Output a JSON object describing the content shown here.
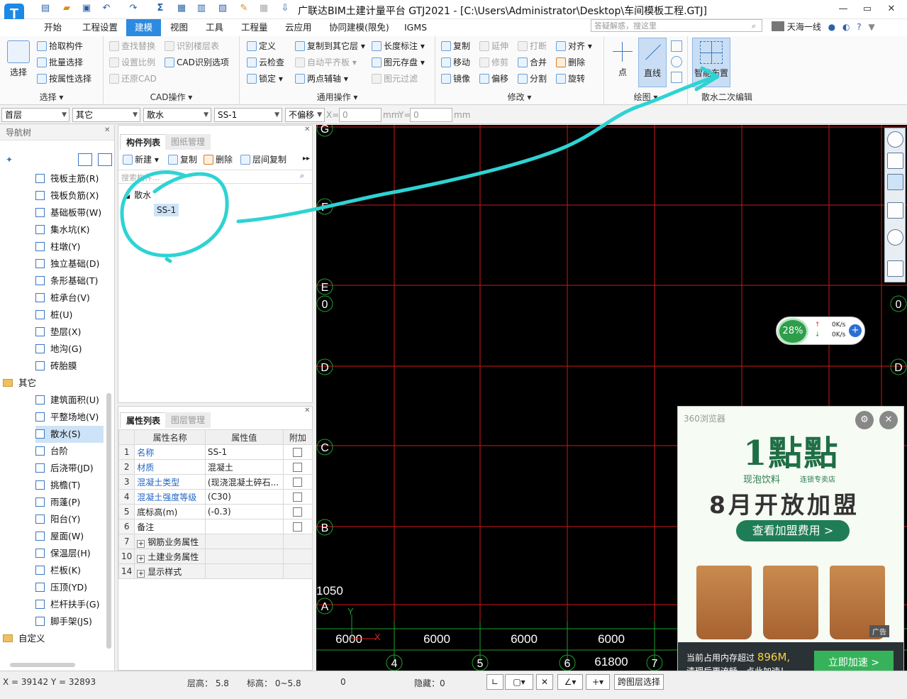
{
  "title": {
    "window_title": "广联达BIM土建计量平台 GTJ2021 - [C:\\Users\\Administrator\\Desktop\\车间模板工程.GTJ]",
    "logo_letter": "T",
    "minimize": "—",
    "restore": "▭",
    "close": "✕"
  },
  "tabs": [
    "开始",
    "工程设置",
    "建模",
    "视图",
    "工具",
    "工程量",
    "云应用",
    "协同建模(限免)",
    "IGMS"
  ],
  "search": {
    "placeholder": "答疑解惑，搜这里"
  },
  "user": {
    "name": "天海一线"
  },
  "ribbon": {
    "select": {
      "big": "选择",
      "label": "选择 ▾",
      "items": [
        "拾取构件",
        "批量选择",
        "按属性选择"
      ]
    },
    "cad": {
      "label": "CAD操作 ▾",
      "items": [
        "查找替换",
        "设置比例",
        "还原CAD",
        "识别楼层表",
        "CAD识别选项"
      ]
    },
    "general": {
      "label": "通用操作 ▾",
      "items": [
        "定义",
        "云检查",
        "锁定 ▾",
        "复制到其它层 ▾",
        "自动平齐板 ▾",
        "两点辅轴 ▾",
        "长度标注 ▾",
        "图元存盘 ▾",
        "图元过滤"
      ]
    },
    "modify": {
      "label": "修改 ▾",
      "items": [
        "复制",
        "移动",
        "镜像",
        "延伸",
        "修剪",
        "偏移",
        "打断",
        "合并",
        "分割",
        "对齐 ▾",
        "删除",
        "旋转"
      ]
    },
    "draw": {
      "label": "绘图 ▾",
      "items": [
        "点",
        "直线"
      ]
    },
    "sanshui": {
      "label": "散水二次编辑",
      "big": "智能布置"
    }
  },
  "combos": {
    "floor": "首层",
    "category": "其它",
    "type": "散水",
    "component": "SS-1",
    "offset": "不偏移",
    "x_label": "X=",
    "x_value": "0",
    "x_unit": "mm",
    "y_label": "Y=",
    "y_value": "0",
    "y_unit": "mm"
  },
  "nav": {
    "title": "导航树",
    "items_top": [
      "筏板主筋(R)",
      "筏板负筋(X)",
      "基础板带(W)",
      "集水坑(K)",
      "柱墩(Y)",
      "独立基础(D)",
      "条形基础(T)",
      "桩承台(V)",
      "桩(U)",
      "垫层(X)",
      "地沟(G)",
      "砖胎膜"
    ],
    "folder_other": "其它",
    "items_other": [
      "建筑面积(U)",
      "平整场地(V)",
      "散水(S)",
      "台阶",
      "后浇带(JD)",
      "挑檐(T)",
      "雨蓬(P)",
      "阳台(Y)",
      "屋面(W)",
      "保温层(H)",
      "栏板(K)",
      "压顶(YD)",
      "栏杆扶手(G)",
      "脚手架(JS)"
    ],
    "folder_custom": "自定义",
    "selected": "散水(S)"
  },
  "complist": {
    "tab1": "构件列表",
    "tab2": "图纸管理",
    "tools": [
      "新建 ▾",
      "复制",
      "删除",
      "层间复制"
    ],
    "search_placeholder": "搜索构件...",
    "tree_root": "散水",
    "tree_child": "SS-1"
  },
  "props": {
    "tab1": "属性列表",
    "tab2": "图层管理",
    "headers": [
      "属性名称",
      "属性值",
      "附加"
    ],
    "rows": [
      {
        "n": "1",
        "k": "名称",
        "v": "SS-1"
      },
      {
        "n": "2",
        "k": "材质",
        "v": "混凝土"
      },
      {
        "n": "3",
        "k": "混凝土类型",
        "v": "(现浇混凝土碎石..."
      },
      {
        "n": "4",
        "k": "混凝土强度等级",
        "v": "(C30)"
      },
      {
        "n": "5",
        "k": "底标高(m)",
        "v": "(-0.3)"
      },
      {
        "n": "6",
        "k": "备注",
        "v": ""
      },
      {
        "n": "7",
        "k": "钢筋业务属性",
        "v": ""
      },
      {
        "n": "10",
        "k": "土建业务属性",
        "v": ""
      },
      {
        "n": "14",
        "k": "显示样式",
        "v": ""
      }
    ]
  },
  "canvas": {
    "axis_rows": [
      "G",
      "F",
      "E",
      "0",
      "D",
      "C",
      "B",
      "A"
    ],
    "axis_right": [
      "0",
      "D"
    ],
    "axis_cols": [
      "4",
      "5",
      "6",
      "7"
    ],
    "dims": [
      "6000",
      "6000",
      "6000",
      "6000"
    ],
    "total_dim": "61800",
    "left_dim": "1050",
    "axis_x": "X",
    "axis_y": "Y"
  },
  "netmon": {
    "percent": "28%",
    "up": "0K/s",
    "down": "0K/s"
  },
  "ad": {
    "browser": "360浏览器",
    "brand": "1點點",
    "sub1": "现泡饮料",
    "sub2": "连锁专卖店",
    "headline": "8月开放加盟",
    "cta": "查看加盟费用 >",
    "tag": "广告",
    "mem_line1": "当前占用内存超过",
    "mem_value": "896M,",
    "mem_line2": "清理后更流畅，点此加速！",
    "speedup": "立即加速 >"
  },
  "status": {
    "coords": "X = 39142 Y = 32893",
    "floor_height": "层高： 5.8",
    "elevation": "标高： 0~5.8",
    "zero": "0",
    "hidden": "隐藏：0",
    "cross_floor": "跨图层选择"
  },
  "colors": {
    "accent": "#2c8ae0",
    "annotation": "#2ed3d3",
    "grid_red": "#d01818",
    "grid_green": "#1f9e2e"
  }
}
